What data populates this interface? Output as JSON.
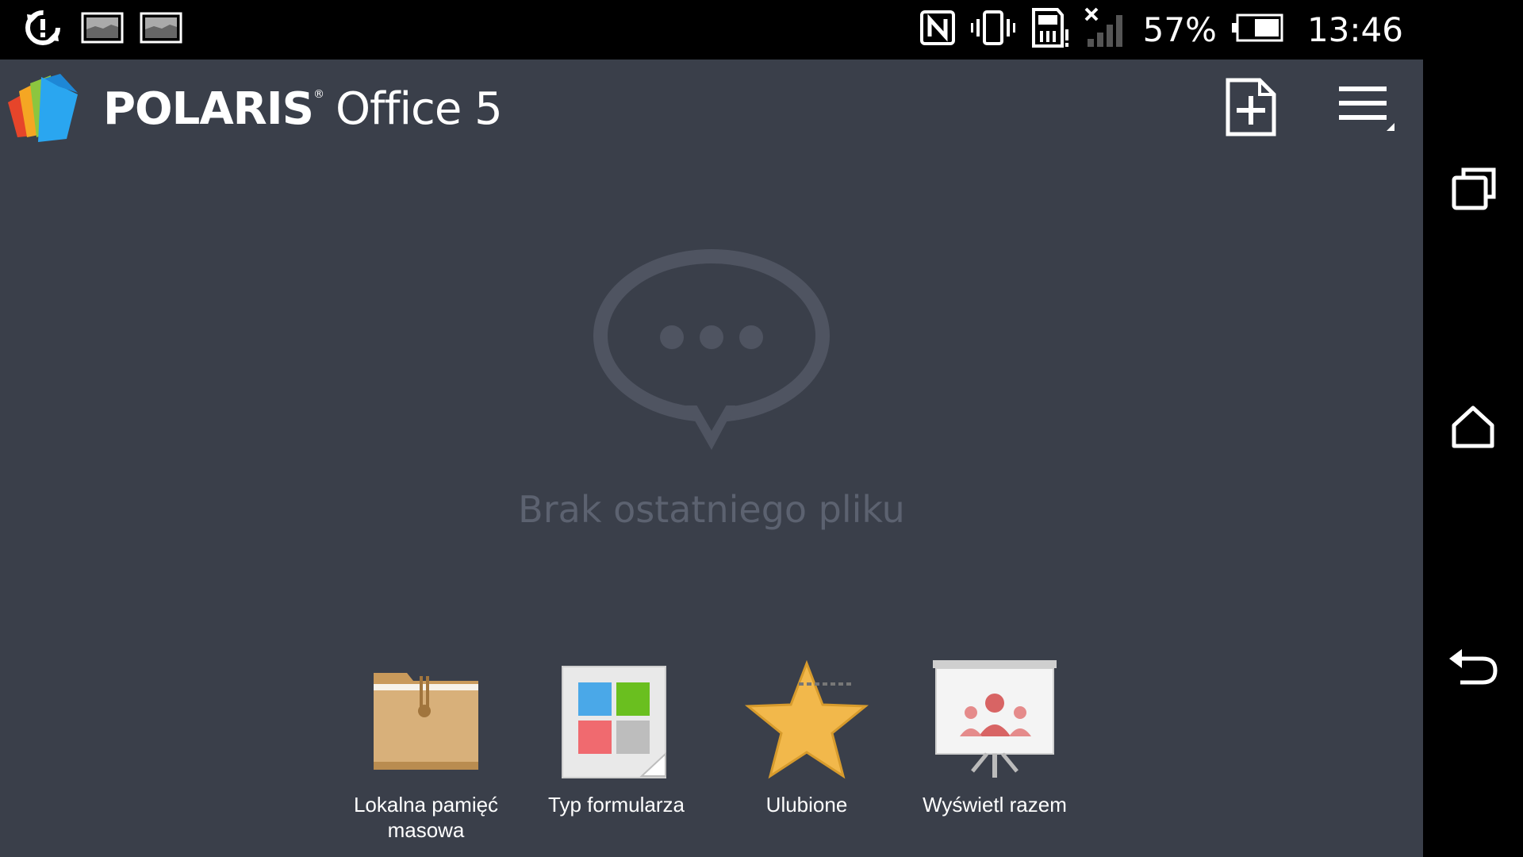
{
  "status_bar": {
    "battery_percent": "57%",
    "time": "13:46",
    "icons": [
      "sync-icon",
      "image-notification-icon",
      "image-notification-icon",
      "nfc-icon",
      "vibrate-icon",
      "sd-card-alert-icon",
      "signal-no-service-icon",
      "battery-icon"
    ]
  },
  "app": {
    "brand_name": "POLARIS",
    "brand_reg": "®",
    "brand_product": "Office 5",
    "empty_state_text": "Brak ostatniego pliku",
    "shortcuts": [
      {
        "label": "Lokalna pamięć masowa",
        "icon": "folder-icon"
      },
      {
        "label": "Typ formularza",
        "icon": "templates-icon"
      },
      {
        "label": "Ulubione",
        "icon": "star-icon"
      },
      {
        "label": "Wyświetl razem",
        "icon": "presentation-icon"
      }
    ],
    "colors": {
      "background": "#3a3f4a",
      "muted_text": "#5c6270",
      "icon_gray": "#4f5461"
    }
  },
  "nav_bar": {
    "buttons": [
      "recent-apps-icon",
      "home-icon",
      "back-icon"
    ]
  }
}
